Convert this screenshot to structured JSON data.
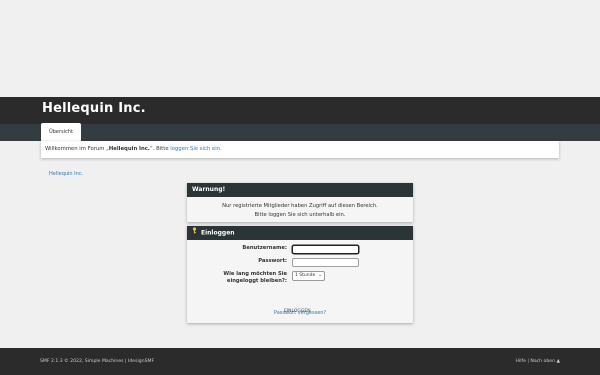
{
  "header": {
    "forum_title": "Hellequin Inc."
  },
  "nav": {
    "tab_label": "Übersicht"
  },
  "welcome": {
    "prefix": "Willkommen im Forum „",
    "forum_name": "Hellequin Inc.",
    "mid": "“. Bitte ",
    "login_link": "loggen Sie sich ein",
    "suffix": "."
  },
  "breadcrumb": {
    "label": "Hellequin Inc."
  },
  "warning": {
    "title": "Warnung!",
    "line1": "Nur registrierte Mitglieder haben Zugriff auf diesen Bereich.",
    "line2": "Bitte loggen Sie sich unterhalb ein."
  },
  "login": {
    "title": "Einloggen",
    "username_label": "Benutzername:",
    "username_value": "",
    "password_label": "Passwort:",
    "password_value": "",
    "stay_label_1": "Wie lang möchten Sie",
    "stay_label_2": "eingeloggt bleiben?:",
    "stay_selected": "1 Stunde",
    "login_button": "EINLOGGEN",
    "forgot_link": "Passwort vergessen?"
  },
  "footer": {
    "left": "SMF 2.1.3 © 2022, Simple Machines | IdesignSMF",
    "right": "Hilfe | Nach oben ▲"
  },
  "colors": {
    "header": "#2b2b2b",
    "navbar": "#333c40",
    "panel_header": "#2b3538",
    "link": "#2e77b5"
  }
}
